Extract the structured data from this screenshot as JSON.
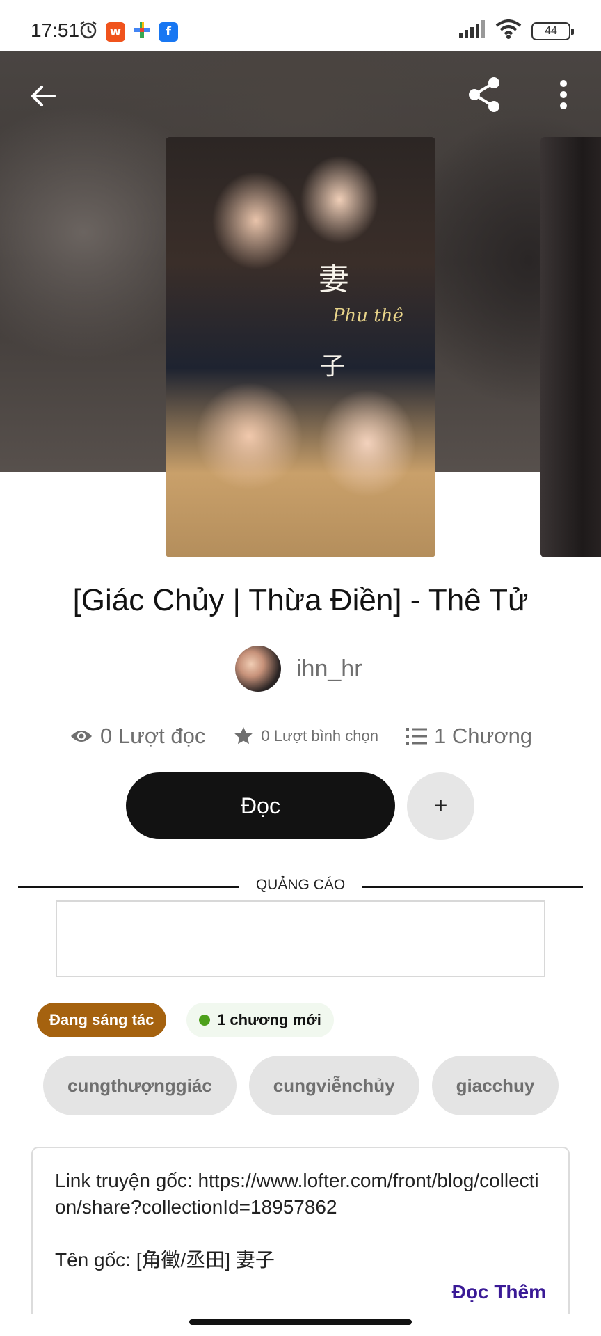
{
  "status_bar": {
    "time": "17:51",
    "battery": "44",
    "left_icons": [
      "alarm-icon",
      "app-w-icon",
      "app-sparkle-icon",
      "facebook-icon"
    ],
    "right_icons": [
      "signal-icon",
      "wifi-icon",
      "battery-icon"
    ]
  },
  "header": {
    "back_icon": "arrow-left-icon",
    "share_icon": "share-icon",
    "menu_icon": "more-vertical-icon"
  },
  "cover": {
    "overlay_line1": "妻",
    "overlay_line2": "Phu thê",
    "overlay_line3": "子"
  },
  "story": {
    "title": "[Giác Chủy | Thừa Điền] - Thê Tử",
    "author": "ihn_hr",
    "reads": "0 Lượt đọc",
    "votes": "0 Lượt bình chọn",
    "chapters": "1 Chương"
  },
  "actions": {
    "read_label": "Đọc",
    "add_label": "+"
  },
  "ad": {
    "label": "QUẢNG CÁO"
  },
  "badges": {
    "status": "Đang sáng tác",
    "new_chapters": "1 chương mới",
    "new_dot_color": "#4da01b",
    "status_color": "#a5620f"
  },
  "tags": [
    "cungthượnggiác",
    "cungviễnchủy",
    "giacchuy"
  ],
  "description": {
    "line1": "Link truyện gốc: https://www.lofter.com/front/blog/collection/share?collectionId=18957862",
    "line2": "Tên gốc: [角徵/丞田] 妻子",
    "more_label": "Đọc Thêm"
  },
  "colors": {
    "read_button": "#121212",
    "add_button": "#e6e6e6",
    "link": "#3a1a96"
  }
}
